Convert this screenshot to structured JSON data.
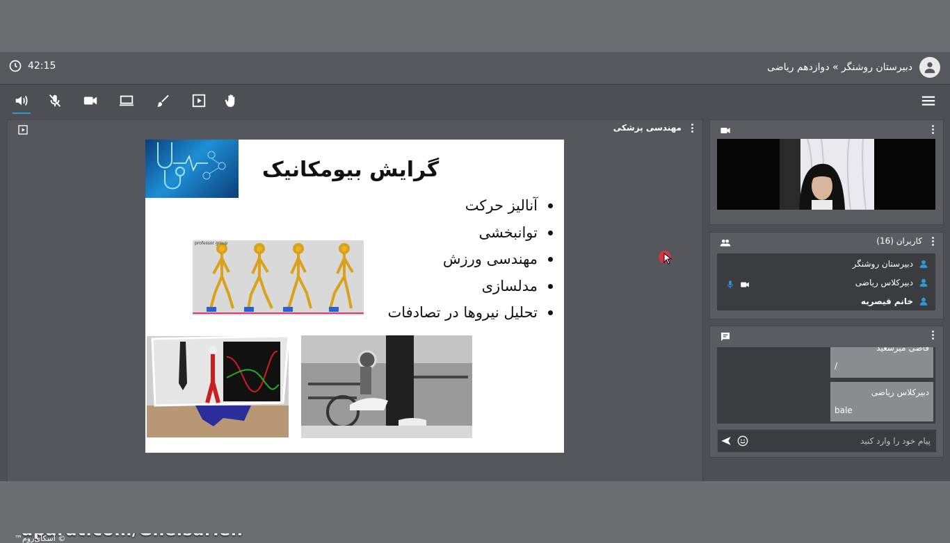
{
  "header": {
    "timer": "42:15",
    "breadcrumb": "دبیرستان روشنگر » دوازدهم ریاضی"
  },
  "toolbar": {
    "icons": [
      "speaker-icon",
      "mic-off-icon",
      "camera-icon",
      "screen-share-icon",
      "brush-icon",
      "play-icon",
      "raise-hand-icon",
      "menu-icon"
    ]
  },
  "presentation": {
    "title": "مهندسی پزشکی",
    "slide": {
      "title": "گرایش بیومکانیک",
      "bullets": [
        "آنالیز حرکت",
        "توانبخشی",
        "مهندسی ورزش",
        "مدلسازی",
        "تحلیل نیروها در تصادفات"
      ],
      "walk_image_caption": "professor group"
    }
  },
  "watermark": "aparat.com/Gheisarieh",
  "brand": "™اسکای‌روم ©",
  "users": {
    "title": "کاربران (16)",
    "list": [
      {
        "name": "دبیرستان روشنگر",
        "bold": false
      },
      {
        "name": "دبیرکلاس ریاضی",
        "bold": false
      },
      {
        "name": "خانم قیصریه",
        "bold": true
      }
    ]
  },
  "chat": {
    "messages": [
      {
        "sender": "قاضی میرسعید",
        "text": "/"
      },
      {
        "sender": "دبیرکلاس ریاضی",
        "text": "bale"
      }
    ],
    "placeholder": "پیام خود را وارد کنید"
  },
  "colors": {
    "accent": "#2b9bd6",
    "panel": "#5a5c61",
    "list_bg": "#3a3c40"
  }
}
